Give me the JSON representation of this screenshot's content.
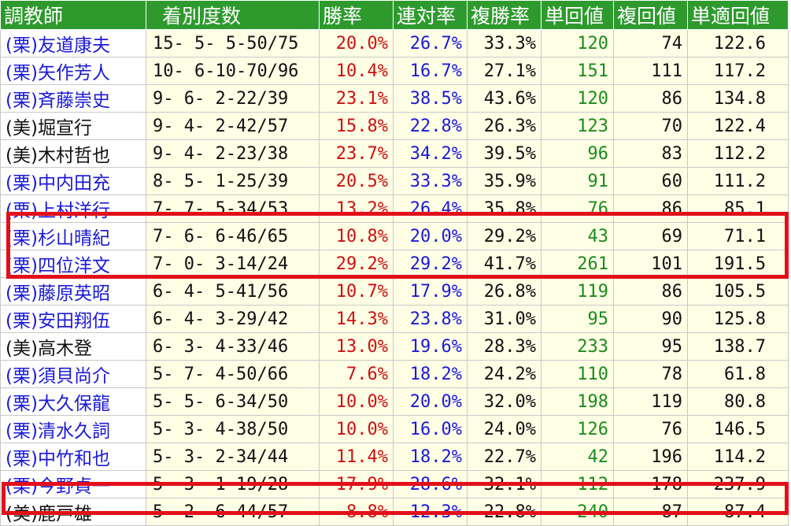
{
  "headers": [
    "調教師",
    "着別度数",
    "勝率",
    "連対率",
    "複勝率",
    "単回値",
    "複回値",
    "単適回値"
  ],
  "rows": [
    {
      "trainer": "(栗)友道康夫",
      "record": "15- 5- 5-50/75",
      "win": "20.0%",
      "ren": "26.7%",
      "fuku": "33.3%",
      "tan": "120",
      "fukuv": "74",
      "adj": "122.6",
      "region": "ritto"
    },
    {
      "trainer": "(栗)矢作芳人",
      "record": "10- 6-10-70/96",
      "win": "10.4%",
      "ren": "16.7%",
      "fuku": "27.1%",
      "tan": "151",
      "fukuv": "111",
      "adj": "117.2",
      "region": "ritto"
    },
    {
      "trainer": "(栗)斉藤崇史",
      "record": "9- 6- 2-22/39",
      "win": "23.1%",
      "ren": "38.5%",
      "fuku": "43.6%",
      "tan": "120",
      "fukuv": "86",
      "adj": "134.8",
      "region": "ritto"
    },
    {
      "trainer": "(美)堀宣行",
      "record": "9- 4- 2-42/57",
      "win": "15.8%",
      "ren": "22.8%",
      "fuku": "26.3%",
      "tan": "123",
      "fukuv": "70",
      "adj": "122.4",
      "region": "miho"
    },
    {
      "trainer": "(美)木村哲也",
      "record": "9- 4- 2-23/38",
      "win": "23.7%",
      "ren": "34.2%",
      "fuku": "39.5%",
      "tan": "96",
      "fukuv": "83",
      "adj": "112.2",
      "region": "miho"
    },
    {
      "trainer": "(栗)中内田充",
      "record": "8- 5- 1-25/39",
      "win": "20.5%",
      "ren": "33.3%",
      "fuku": "35.9%",
      "tan": "91",
      "fukuv": "60",
      "adj": "111.2",
      "region": "ritto"
    },
    {
      "trainer": "(栗)上村洋行",
      "record": "7- 7- 5-34/53",
      "win": "13.2%",
      "ren": "26.4%",
      "fuku": "35.8%",
      "tan": "76",
      "fukuv": "86",
      "adj": "85.1",
      "region": "ritto"
    },
    {
      "trainer": "(栗)杉山晴紀",
      "record": "7- 6- 6-46/65",
      "win": "10.8%",
      "ren": "20.0%",
      "fuku": "29.2%",
      "tan": "43",
      "fukuv": "69",
      "adj": "71.1",
      "region": "ritto"
    },
    {
      "trainer": "(栗)四位洋文",
      "record": "7- 0- 3-14/24",
      "win": "29.2%",
      "ren": "29.2%",
      "fuku": "41.7%",
      "tan": "261",
      "fukuv": "101",
      "adj": "191.5",
      "region": "ritto"
    },
    {
      "trainer": "(栗)藤原英昭",
      "record": "6- 4- 5-41/56",
      "win": "10.7%",
      "ren": "17.9%",
      "fuku": "26.8%",
      "tan": "119",
      "fukuv": "86",
      "adj": "105.5",
      "region": "ritto"
    },
    {
      "trainer": "(栗)安田翔伍",
      "record": "6- 4- 3-29/42",
      "win": "14.3%",
      "ren": "23.8%",
      "fuku": "31.0%",
      "tan": "95",
      "fukuv": "90",
      "adj": "125.8",
      "region": "ritto"
    },
    {
      "trainer": "(美)高木登",
      "record": "6- 3- 4-33/46",
      "win": "13.0%",
      "ren": "19.6%",
      "fuku": "28.3%",
      "tan": "233",
      "fukuv": "95",
      "adj": "138.7",
      "region": "miho"
    },
    {
      "trainer": "(栗)須貝尚介",
      "record": "5- 7- 4-50/66",
      "win": "7.6%",
      "ren": "18.2%",
      "fuku": "24.2%",
      "tan": "110",
      "fukuv": "78",
      "adj": "61.8",
      "region": "ritto"
    },
    {
      "trainer": "(栗)大久保龍",
      "record": "5- 5- 6-34/50",
      "win": "10.0%",
      "ren": "20.0%",
      "fuku": "32.0%",
      "tan": "198",
      "fukuv": "119",
      "adj": "80.8",
      "region": "ritto"
    },
    {
      "trainer": "(栗)清水久詞",
      "record": "5- 3- 4-38/50",
      "win": "10.0%",
      "ren": "16.0%",
      "fuku": "24.0%",
      "tan": "126",
      "fukuv": "76",
      "adj": "146.5",
      "region": "ritto"
    },
    {
      "trainer": "(栗)中竹和也",
      "record": "5- 3- 2-34/44",
      "win": "11.4%",
      "ren": "18.2%",
      "fuku": "22.7%",
      "tan": "42",
      "fukuv": "196",
      "adj": "114.2",
      "region": "ritto"
    },
    {
      "trainer": "(栗)今野貞一",
      "record": "5- 3- 1-19/28",
      "win": "17.9%",
      "ren": "28.6%",
      "fuku": "32.1%",
      "tan": "112",
      "fukuv": "178",
      "adj": "237.9",
      "region": "ritto"
    },
    {
      "trainer": "(美)鹿戸雄一",
      "record": "5- 2- 6-44/57",
      "win": "8.8%",
      "ren": "12.3%",
      "fuku": "22.8%",
      "tan": "240",
      "fukuv": "87",
      "adj": "87.4",
      "region": "miho"
    }
  ],
  "colors": {
    "header_bg": "#2e9a2e",
    "ritto_text": "#1a1ad6",
    "miho_text": "#101010",
    "win_text": "#cc1010",
    "tan_text": "#1a8c1a",
    "cell_bg": "#ffffe6",
    "highlight": "#e2101a"
  }
}
